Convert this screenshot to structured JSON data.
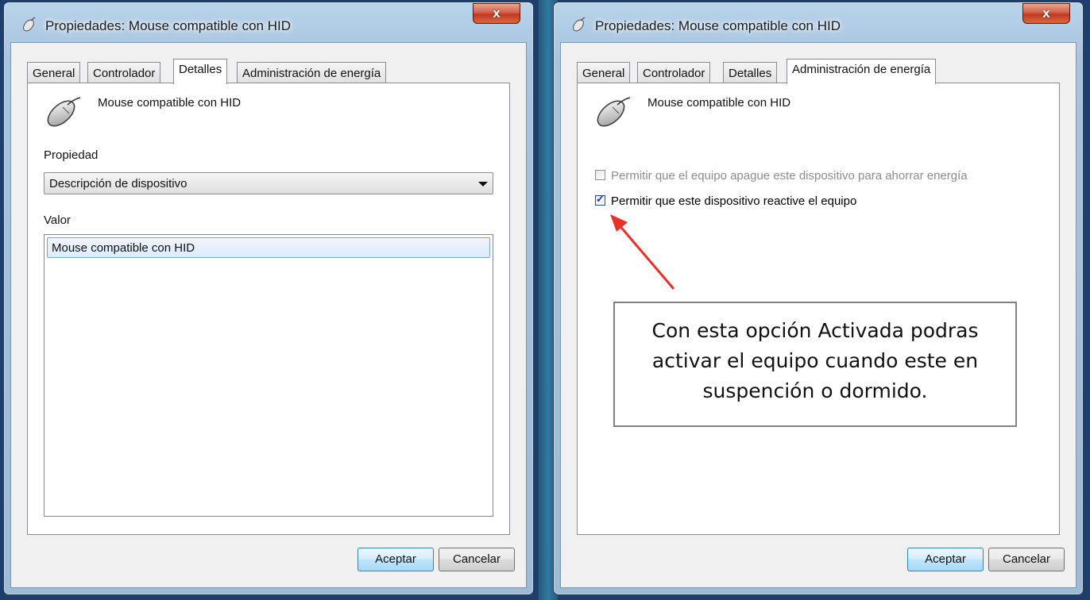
{
  "windows": [
    {
      "title": "Propiedades: Mouse compatible con HID",
      "close_glyph": "x",
      "tabs": [
        "General",
        "Controlador",
        "Detalles",
        "Administración de energía"
      ],
      "active_tab": "Detalles",
      "device_name": "Mouse compatible con HID",
      "property_label": "Propiedad",
      "property_selected": "Descripción de dispositivo",
      "value_label": "Valor",
      "value_items": [
        "Mouse compatible con HID"
      ],
      "ok_label": "Aceptar",
      "cancel_label": "Cancelar"
    },
    {
      "title": "Propiedades: Mouse compatible con HID",
      "close_glyph": "x",
      "tabs": [
        "General",
        "Controlador",
        "Detalles",
        "Administración de energía"
      ],
      "active_tab": "Administración de energía",
      "device_name": "Mouse compatible con HID",
      "checkboxes": [
        {
          "label": "Permitir que el equipo apague este dispositivo para ahorrar energía",
          "checked": false,
          "enabled": false
        },
        {
          "label": "Permitir que este dispositivo reactive el equipo",
          "checked": true,
          "enabled": true
        }
      ],
      "ok_label": "Aceptar",
      "cancel_label": "Cancelar"
    }
  ],
  "annotation": {
    "lines": [
      "Con esta opción Activada podras",
      "activar el equipo cuando este en",
      "suspención o dormido."
    ],
    "arrow_color": "#e8312a"
  },
  "icons": {
    "window_icon": "mouse-icon",
    "device_icon": "mouse-icon",
    "check_glyph": "✓"
  }
}
